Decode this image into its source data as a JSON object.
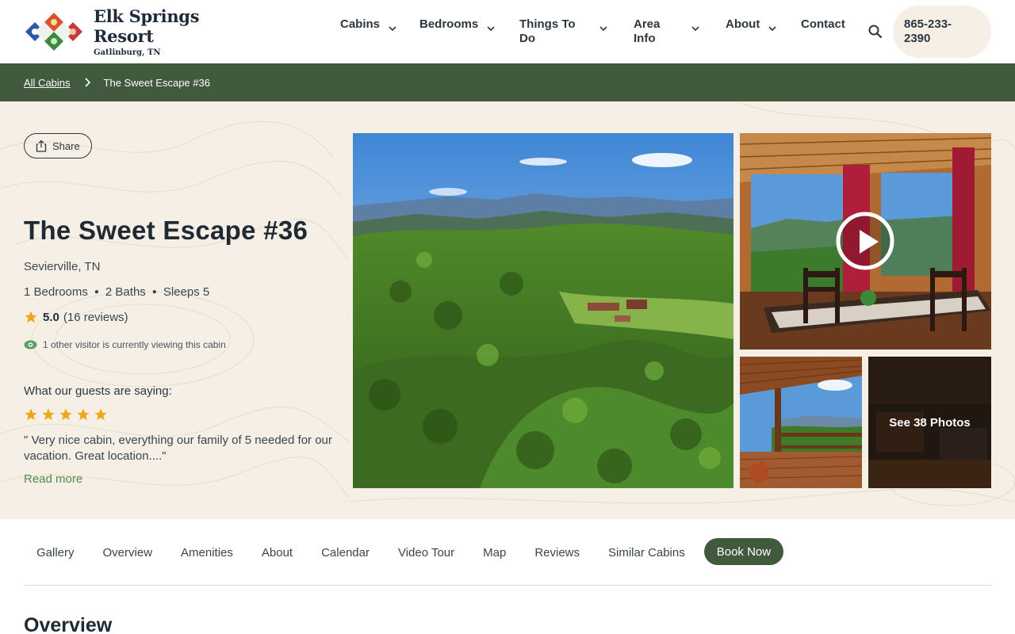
{
  "brand": {
    "name": "Elk Springs Resort",
    "tagline": "Gatlinburg, TN",
    "colors": {
      "forest": "#415a3e",
      "sand": "#f5efe6",
      "link_green": "#4f8a4a",
      "star_gold": "#f2a516",
      "text_dark": "#1f2a33"
    }
  },
  "nav": {
    "items": [
      {
        "label": "Cabins",
        "has_dropdown": true
      },
      {
        "label": "Bedrooms",
        "has_dropdown": true
      },
      {
        "label": "Things To Do",
        "has_dropdown": true
      },
      {
        "label": "Area Info",
        "has_dropdown": true
      },
      {
        "label": "About",
        "has_dropdown": true
      },
      {
        "label": "Contact",
        "has_dropdown": false
      }
    ],
    "search_icon": "search-icon",
    "phone": "865-233-2390"
  },
  "breadcrumb": {
    "parent": "All Cabins",
    "current": "The Sweet Escape #36"
  },
  "listing": {
    "share_label": "Share",
    "title": "The Sweet Escape #36",
    "location": "Sevierville, TN",
    "bedrooms": "1 Bedrooms",
    "baths": "2 Baths",
    "sleeps": "Sleeps 5",
    "rating": "5.0",
    "reviews": "(16 reviews)",
    "viewing_notice": "1 other visitor is currently viewing this cabin",
    "guests_heading": "What our guests are saying:",
    "testimonial_stars": 5,
    "testimonial": "\" Very nice cabin, everything our family of 5 needed for our vacation. Great location....\"",
    "read_more": "Read more"
  },
  "gallery": {
    "see_photos_label": "See 38 Photos",
    "play_icon": "play-icon"
  },
  "tabs": [
    {
      "label": "Gallery"
    },
    {
      "label": "Overview"
    },
    {
      "label": "Amenities"
    },
    {
      "label": "About"
    },
    {
      "label": "Calendar"
    },
    {
      "label": "Video Tour"
    },
    {
      "label": "Map"
    },
    {
      "label": "Reviews"
    },
    {
      "label": "Similar Cabins"
    },
    {
      "label": "Book Now"
    }
  ],
  "section": {
    "overview_heading": "Overview"
  }
}
